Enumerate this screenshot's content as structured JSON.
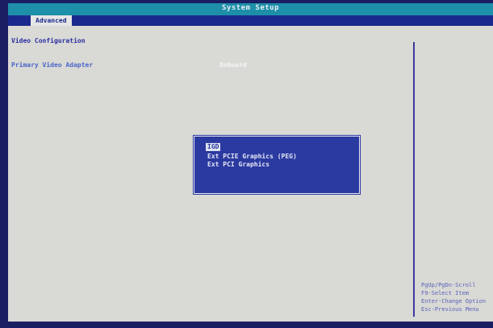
{
  "window": {
    "title": "System Setup"
  },
  "tabs": {
    "active": "Advanced"
  },
  "content": {
    "section_title": "Video Configuration",
    "primary_label": "Primary Video Adapter",
    "primary_value": "Onboard"
  },
  "popup": {
    "options": [
      "IGD",
      "Ext PCIE Graphics (PEG)",
      "Ext PCI Graphics"
    ],
    "selected_index": 0
  },
  "help": {
    "lines": [
      "PgUp/PgDn-Scroll",
      "F9-Select Item",
      "Enter-Change Option",
      "Esc-Previous Menu"
    ]
  },
  "colors": {
    "frame": "#1a1f63",
    "title_bar": "#1e8fa8",
    "tab_strip": "#1a2a8c",
    "content_bg": "#d9d9d6",
    "popup_bg": "#2b3aa0"
  }
}
